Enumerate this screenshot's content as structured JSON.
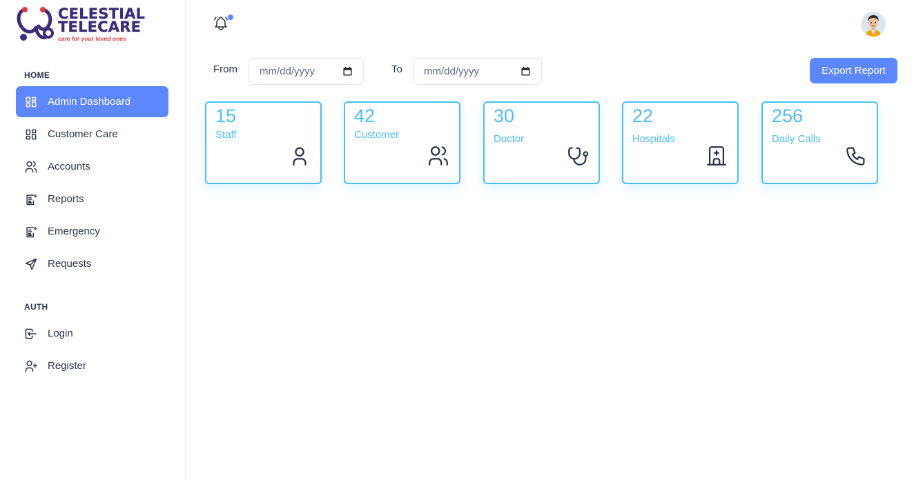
{
  "brand": {
    "line1": "CELESTIAL",
    "line2": "TELECARE",
    "tagline": "care for your loved ones"
  },
  "sidebar": {
    "sections": [
      {
        "label": "HOME"
      },
      {
        "label": "AUTH"
      }
    ],
    "items": [
      {
        "label": "Admin Dashboard",
        "icon": "dashboard-icon",
        "active": true
      },
      {
        "label": "Customer Care",
        "icon": "dashboard-icon"
      },
      {
        "label": "Accounts",
        "icon": "users-icon"
      },
      {
        "label": "Reports",
        "icon": "report-icon"
      },
      {
        "label": "Emergency",
        "icon": "report-icon"
      },
      {
        "label": "Requests",
        "icon": "send-icon"
      },
      {
        "label": "Login",
        "icon": "login-icon"
      },
      {
        "label": "Register",
        "icon": "user-plus-icon"
      }
    ]
  },
  "filters": {
    "from_label": "From",
    "from_placeholder": "mm/dd/yyyy",
    "to_label": "To",
    "to_placeholder": "mm/dd/yyyy",
    "export_label": "Export Report"
  },
  "stats": [
    {
      "value": "15",
      "label": "Staff",
      "icon": "user-icon"
    },
    {
      "value": "42",
      "label": "Customer",
      "icon": "users-icon"
    },
    {
      "value": "30",
      "label": "Doctor",
      "icon": "stethoscope-icon"
    },
    {
      "value": "22",
      "label": "Hospitals",
      "icon": "hospital-icon"
    },
    {
      "value": "256",
      "label": "Daily Calls",
      "icon": "phone-icon"
    }
  ],
  "colors": {
    "primary": "#5d87ff",
    "card_accent": "#49beff",
    "text": "#2a3547",
    "brand_purple": "#3b2b7a",
    "brand_red": "#e03a3a"
  }
}
